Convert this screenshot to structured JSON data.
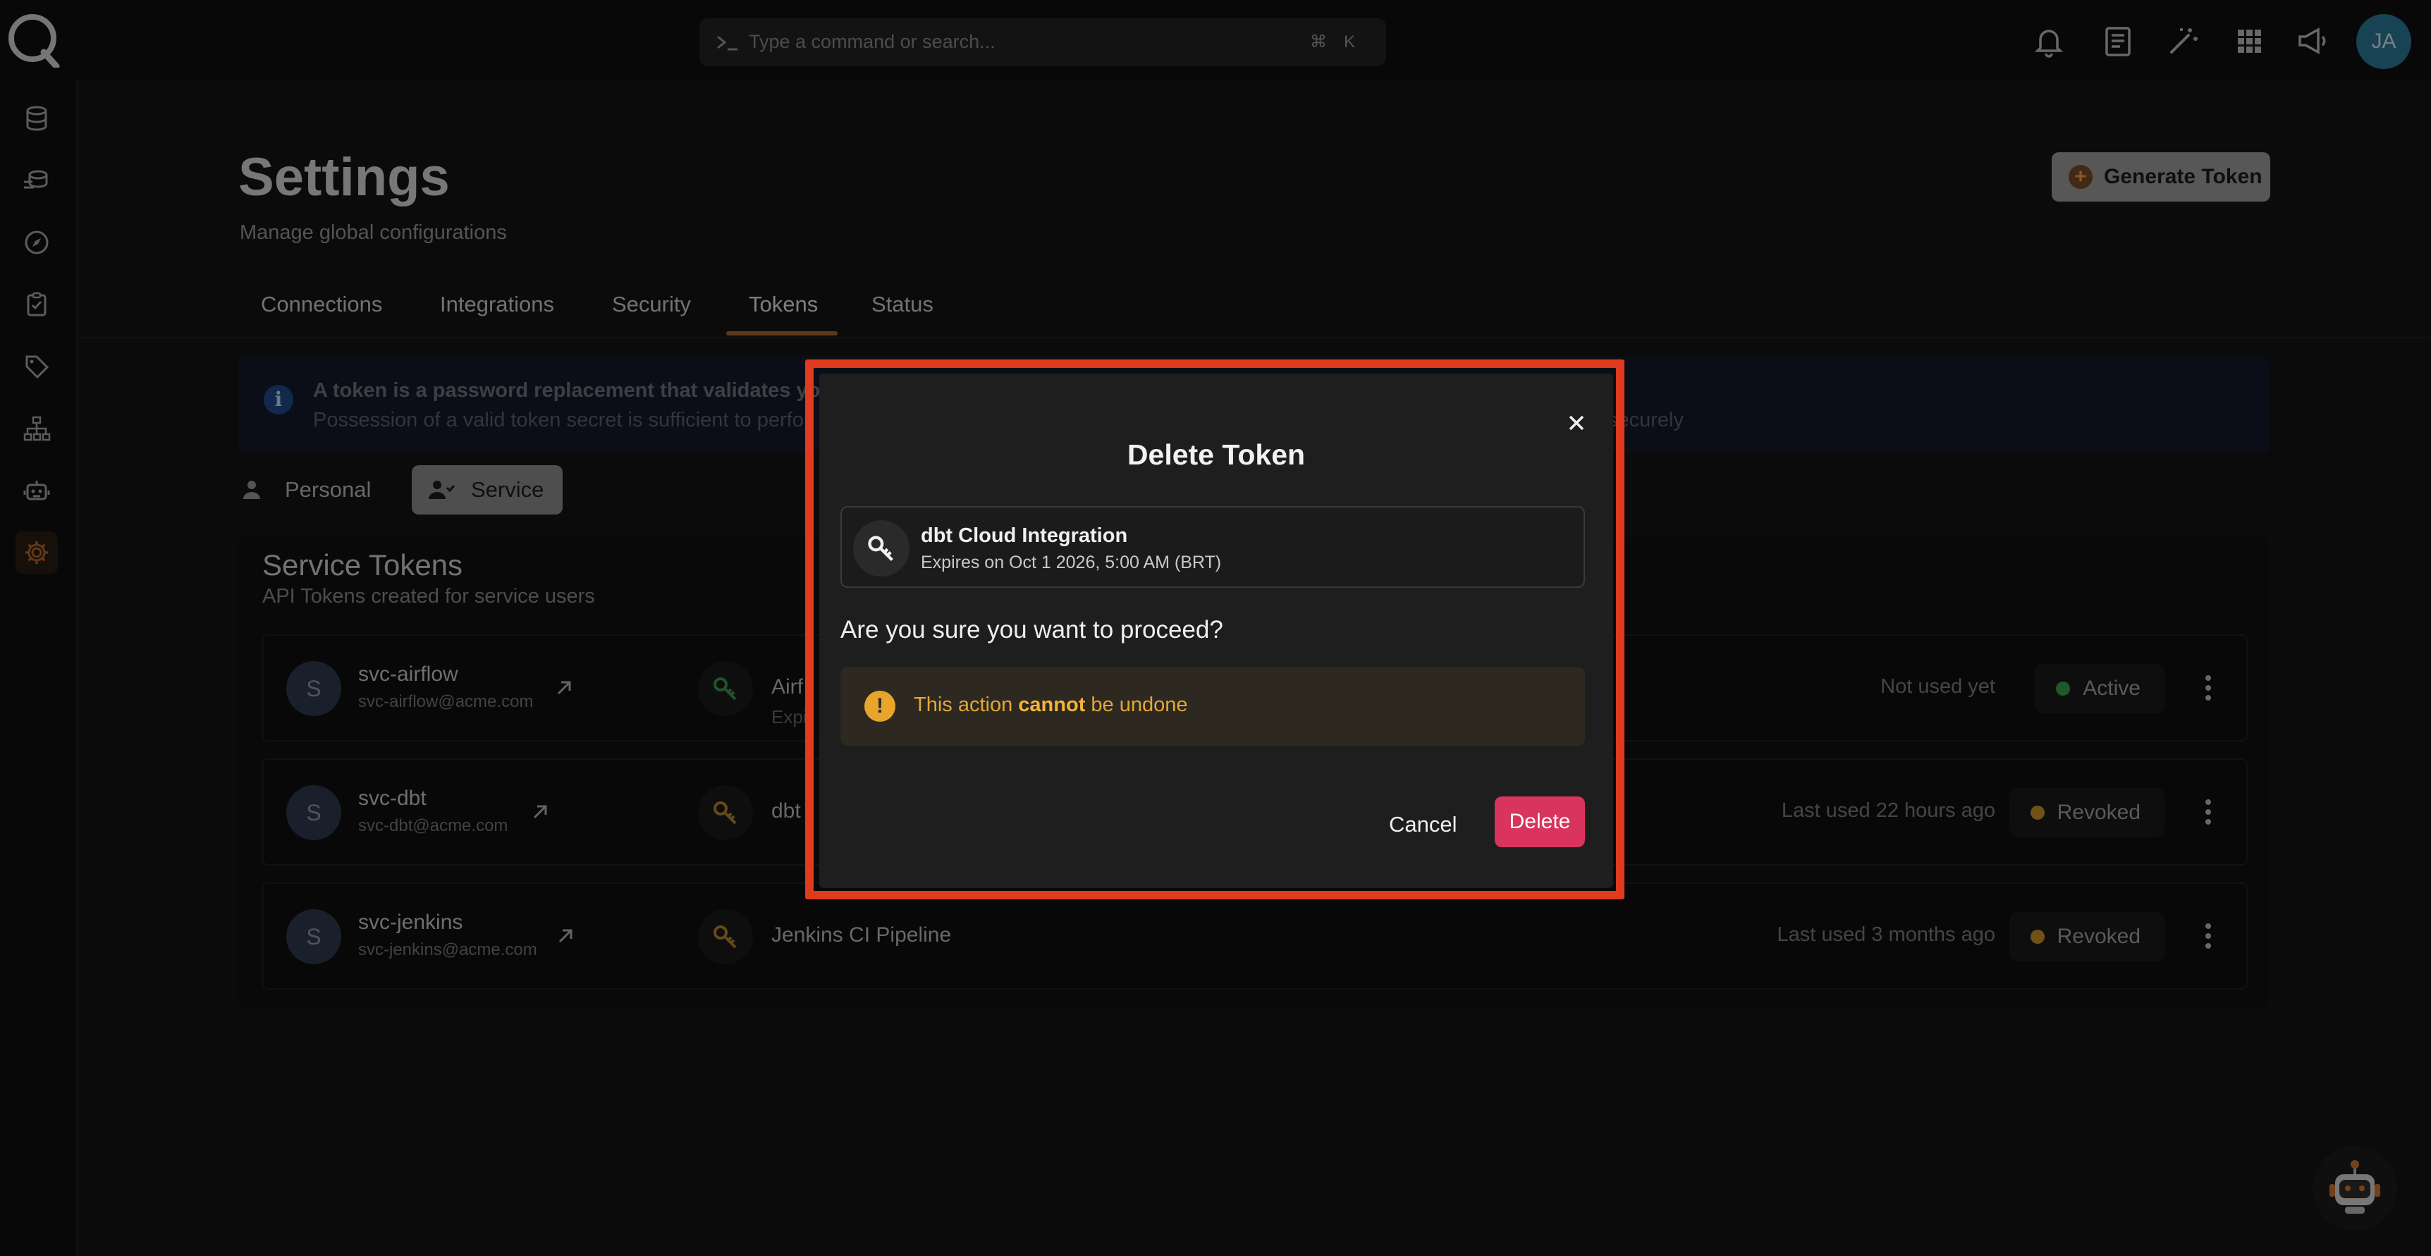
{
  "search": {
    "placeholder": "Type a command or search...",
    "shortcut_mod": "⌘",
    "shortcut_key": "K"
  },
  "user": {
    "initials": "JA",
    "avatar_color": "#2a7b9b"
  },
  "page": {
    "title": "Settings",
    "subtitle": "Manage global configurations",
    "generate_button": "Generate Token"
  },
  "tabs": [
    {
      "label": "Connections",
      "active": false
    },
    {
      "label": "Integrations",
      "active": false
    },
    {
      "label": "Security",
      "active": false
    },
    {
      "label": "Tokens",
      "active": true
    },
    {
      "label": "Status",
      "active": false
    }
  ],
  "info": {
    "line1": "A token is a password replacement that validates you",
    "line2": "Possession of a valid token secret is sufficient to perfor",
    "line2_tail": "securely"
  },
  "segments": {
    "personal": "Personal",
    "service": "Service",
    "active": "Service"
  },
  "service_tokens": {
    "title": "Service Tokens",
    "subtitle": "API Tokens created for service users",
    "rows": [
      {
        "avatar": "S",
        "user": "svc-airflow",
        "email": "svc-airflow@acme.com",
        "token_name": "Airf",
        "token_sub": "Expi",
        "key_color": "#3f9a4c",
        "last_used": "Not used yet",
        "status": "Active",
        "status_color": "#3aa24a"
      },
      {
        "avatar": "S",
        "user": "svc-dbt",
        "email": "svc-dbt@acme.com",
        "token_name": "dbt",
        "token_sub": "",
        "key_color": "#b8862f",
        "last_used": "Last used 22 hours ago",
        "status": "Revoked",
        "status_color": "#c9962c"
      },
      {
        "avatar": "S",
        "user": "svc-jenkins",
        "email": "svc-jenkins@acme.com",
        "token_name": "Jenkins CI Pipeline",
        "token_sub": "",
        "key_color": "#b8862f",
        "last_used": "Last used 3 months ago",
        "status": "Revoked",
        "status_color": "#c9962c"
      }
    ]
  },
  "modal": {
    "title": "Delete Token",
    "token_name": "dbt Cloud Integration",
    "token_expiry": "Expires on Oct 1 2026, 5:00 AM (BRT)",
    "question": "Are you sure you want to proceed?",
    "warning_prefix": "This action ",
    "warning_emphasis": "cannot",
    "warning_suffix": " be undone",
    "cancel_label": "Cancel",
    "delete_label": "Delete",
    "delete_color": "#d9345e",
    "highlight_color": "#e03a1f"
  }
}
